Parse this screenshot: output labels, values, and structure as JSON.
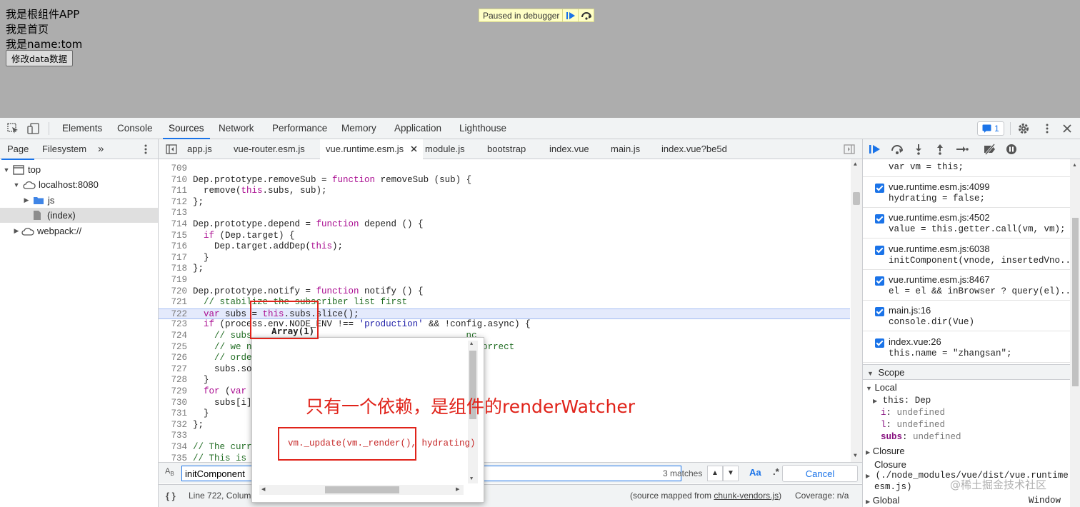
{
  "page": {
    "lines": [
      "我是根组件APP",
      "我是首页",
      "我是name:tom"
    ],
    "button_label": "修改data数据",
    "paused_text": "Paused in debugger"
  },
  "devtools": {
    "tabs": [
      "Elements",
      "Console",
      "Sources",
      "Network",
      "Performance",
      "Memory",
      "Application",
      "Lighthouse"
    ],
    "active_tab": "Sources",
    "issues_count": "1"
  },
  "navigator": {
    "tabs": [
      "Page",
      "Filesystem"
    ],
    "more": "»",
    "tree": [
      {
        "label": "top"
      },
      {
        "label": "localhost:8080"
      },
      {
        "label": "js"
      },
      {
        "label": "(index)"
      },
      {
        "label": "webpack://"
      }
    ]
  },
  "editor": {
    "file_tabs": [
      "app.js",
      "vue-router.esm.js",
      "vue.runtime.esm.js",
      "module.js",
      "bootstrap",
      "index.vue",
      "main.js",
      "index.vue?be5d"
    ],
    "active_file": "vue.runtime.esm.js",
    "code_lines": [
      {
        "n": "709",
        "t": ""
      },
      {
        "n": "710",
        "t": "Dep.prototype.removeSub = function removeSub (sub) {"
      },
      {
        "n": "711",
        "t": "  remove(this.subs, sub);"
      },
      {
        "n": "712",
        "t": "};"
      },
      {
        "n": "713",
        "t": ""
      },
      {
        "n": "714",
        "t": "Dep.prototype.depend = function depend () {"
      },
      {
        "n": "715",
        "t": "  if (Dep.target) {"
      },
      {
        "n": "716",
        "t": "    Dep.target.addDep(this);"
      },
      {
        "n": "717",
        "t": "  }"
      },
      {
        "n": "718",
        "t": "};"
      },
      {
        "n": "719",
        "t": ""
      },
      {
        "n": "720",
        "t": "Dep.prototype.notify = function notify () {"
      },
      {
        "n": "721",
        "t": "  // stabilize the subscriber list first"
      },
      {
        "n": "722",
        "t": "  var subs = this.subs.slice();"
      },
      {
        "n": "723",
        "t": "  if (process.env.NODE_ENV !== 'production' && !config.async) {"
      },
      {
        "n": "724",
        "t": "    // subs                                        nc"
      },
      {
        "n": "725",
        "t": "    // we ne                                         correct"
      },
      {
        "n": "726",
        "t": "    // order"
      },
      {
        "n": "727",
        "t": "    subs.sor"
      },
      {
        "n": "728",
        "t": "  }"
      },
      {
        "n": "729",
        "t": "  for (var i"
      },
      {
        "n": "730",
        "t": "    subs[i]."
      },
      {
        "n": "731",
        "t": "  }"
      },
      {
        "n": "732",
        "t": "};"
      },
      {
        "n": "733",
        "t": ""
      },
      {
        "n": "734",
        "t": "// The curre"
      },
      {
        "n": "735",
        "t": "// This is g"
      }
    ],
    "search": {
      "query": "initComponent",
      "matches": "3 matches",
      "case_label": "Aa",
      "regex_label": ".*",
      "cancel": "Cancel"
    },
    "status": {
      "position": "Line 722, Colum",
      "source_mapped_prefix": "(source mapped from ",
      "source_mapped_file": "chunk-vendors.js",
      "coverage": "Coverage: n/a"
    }
  },
  "popover": {
    "title": "Array(1)",
    "content": "vm._update(vm._render(), hydrating)"
  },
  "annotation": "只有一个依赖，是组件的renderWatcher",
  "debugger": {
    "call_stack": [
      {
        "loc": "",
        "code": "var vm = this;"
      },
      {
        "loc": "vue.runtime.esm.js:4099",
        "code": "hydrating = false;"
      },
      {
        "loc": "vue.runtime.esm.js:4502",
        "code": "value = this.getter.call(vm, vm);"
      },
      {
        "loc": "vue.runtime.esm.js:6038",
        "code": "initComponent(vnode, insertedVno..."
      },
      {
        "loc": "vue.runtime.esm.js:8467",
        "code": "el = el && inBrowser ? query(el)..."
      },
      {
        "loc": "main.js:16",
        "code": "console.dir(Vue)"
      },
      {
        "loc": "index.vue:26",
        "code": "this.name = \"zhangsan\";"
      }
    ],
    "scope_title": "Scope",
    "local_title": "Local",
    "local_vars": [
      {
        "name": "this",
        "value": "Dep"
      },
      {
        "name": "i",
        "value": "undefined"
      },
      {
        "name": "l",
        "value": "undefined"
      },
      {
        "name": "subs",
        "value": "undefined"
      }
    ],
    "closure_title": "Closure",
    "closure2_title": "Closure",
    "closure2_path": "(./node_modules/vue/dist/vue.runtime.",
    "closure2_path2": "esm.js)",
    "global_title": "Global",
    "global_value": "Window"
  },
  "watermark": "@稀土掘金技术社区",
  "colors": {
    "accent": "#1a73e8",
    "annotation_red": "#e0231a",
    "page_bg": "#adadad"
  }
}
